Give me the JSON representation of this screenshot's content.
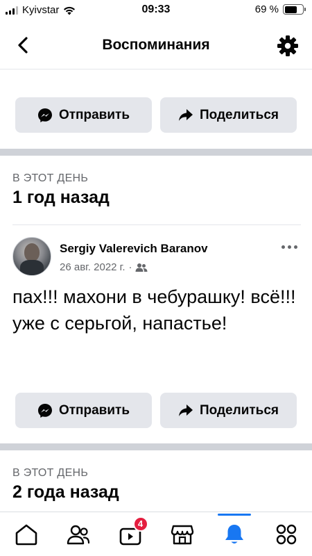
{
  "status_bar": {
    "carrier": "Kyivstar",
    "time": "09:33",
    "battery_text": "69 %",
    "battery_level": 0.69
  },
  "header": {
    "title": "Воспоминания"
  },
  "actions": {
    "send_label": "Отправить",
    "share_label": "Поделиться"
  },
  "memories": [
    {
      "kicker": "В ЭТОТ ДЕНЬ",
      "title": "1 год назад",
      "post": {
        "author": "Sergiy Valerevich Baranov",
        "date": "26 авг. 2022 г.",
        "separator": "·",
        "text": "пах!!! махони в чебурашку! всё!!! уже с серьгой, напастье!"
      }
    },
    {
      "kicker": "В ЭТОТ ДЕНЬ",
      "title": "2 года назад"
    }
  ],
  "bottom_nav": {
    "video_badge": "4",
    "active": "notifications"
  },
  "colors": {
    "accent": "#1877f2",
    "button_bg": "#e4e6eb",
    "badge": "#e41e3f",
    "secondary_text": "#65676b"
  }
}
